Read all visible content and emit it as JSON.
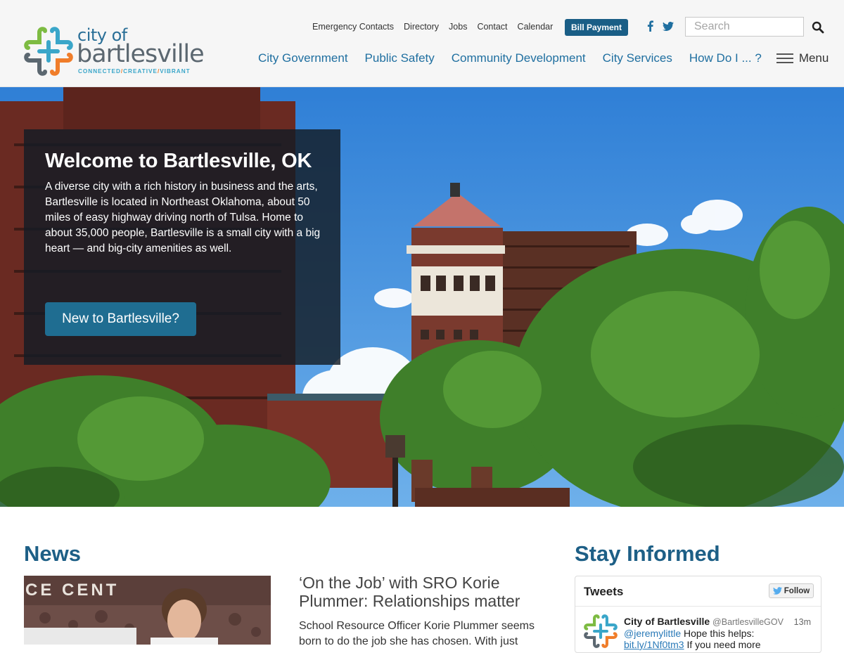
{
  "header": {
    "logo": {
      "city": "city of",
      "name": "bartlesville",
      "tagline": [
        "CONNECTED",
        "CREATIVE",
        "VIBRANT"
      ]
    },
    "util_nav": [
      "Emergency Contacts",
      "Directory",
      "Jobs",
      "Contact",
      "Calendar"
    ],
    "bill_payment": "Bill Payment",
    "social": [
      "facebook-icon",
      "twitter-icon"
    ],
    "search": {
      "placeholder": "Search",
      "value": ""
    },
    "main_nav": [
      "City Government",
      "Public Safety",
      "Community Development",
      "City Services",
      "How Do I ... ?"
    ],
    "menu_label": "Menu"
  },
  "hero": {
    "title": "Welcome to Bartlesville, OK",
    "text": "A diverse city with a rich history in business and the arts, Bartlesville is located in Northeast Oklahoma, about 50 miles of easy highway driving north of Tulsa. Home to about 35,000 people, Bartlesville is a small city with a big heart — and big-city amenities as well.",
    "button": "New to Bartlesville?"
  },
  "news": {
    "heading": "News",
    "image_sign": "CE CENT",
    "title": "‘On the Job’ with SRO Korie Plummer: Relationships matter",
    "excerpt": "School Resource Officer Korie Plummer seems born to do the job she has chosen. With just"
  },
  "stay_informed": {
    "heading": "Stay Informed",
    "tweets_label": "Tweets",
    "follow": "Follow",
    "tweet": {
      "name": "City of Bartlesville",
      "handle": "@BartlesvilleGOV",
      "time": "13m",
      "mention": "@jeremylittle",
      "text": "Hope this helps:",
      "link": "bit.ly/1Nf0tm3",
      "after": "If you need more"
    }
  },
  "colors": {
    "brand_blue": "#1d5f86",
    "nav_blue": "#1f6fa0",
    "logo_green": "#7dbb42",
    "logo_orange": "#f07d2a",
    "logo_teal": "#3aa6c9",
    "logo_grey": "#5b6770"
  }
}
